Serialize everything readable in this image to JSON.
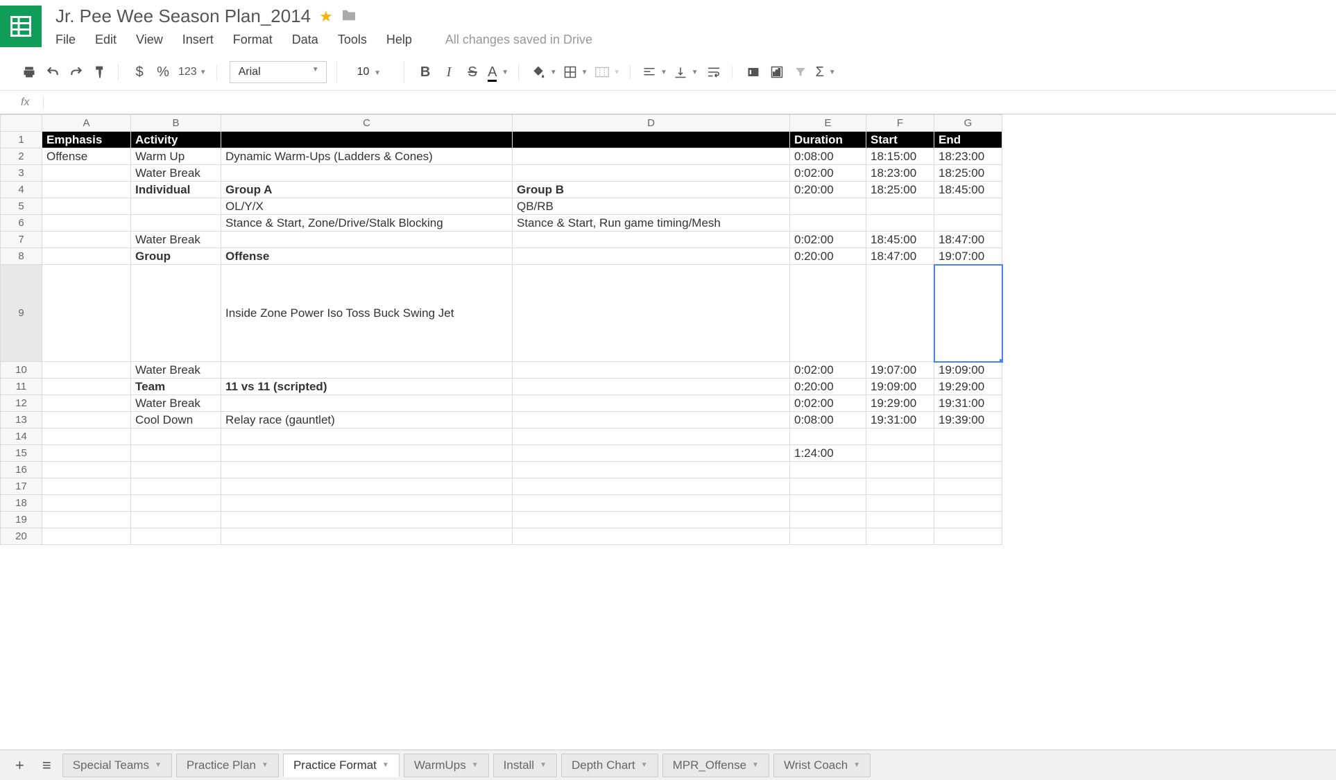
{
  "doc": {
    "title": "Jr. Pee Wee Season Plan_2014",
    "save_status": "All changes saved in Drive"
  },
  "menu": {
    "file": "File",
    "edit": "Edit",
    "view": "View",
    "insert": "Insert",
    "format": "Format",
    "data": "Data",
    "tools": "Tools",
    "help": "Help"
  },
  "toolbar": {
    "currency": "$",
    "percent": "%",
    "numfmt": "123",
    "font": "Arial",
    "fontsize": "10",
    "bold": "B",
    "italic": "I",
    "strike": "S",
    "textA": "A",
    "sigma": "Σ"
  },
  "fx": {
    "label": "fx"
  },
  "cols": {
    "A": "A",
    "B": "B",
    "C": "C",
    "D": "D",
    "E": "E",
    "F": "F",
    "G": "G"
  },
  "headers": {
    "emphasis": "Emphasis",
    "activity": "Activity",
    "duration": "Duration",
    "start": "Start",
    "end": "End"
  },
  "rows": {
    "r2": {
      "a": "Offense",
      "b": "Warm Up",
      "c": "Dynamic Warm-Ups (Ladders & Cones)",
      "e": "0:08:00",
      "f": "18:15:00",
      "g": "18:23:00"
    },
    "r3": {
      "b": "Water Break",
      "e": "0:02:00",
      "f": "18:23:00",
      "g": "18:25:00"
    },
    "r4": {
      "b": "Individual",
      "c": "Group A",
      "d": "Group B",
      "e": "0:20:00",
      "f": "18:25:00",
      "g": "18:45:00"
    },
    "r5": {
      "c": "OL/Y/X",
      "d": "QB/RB"
    },
    "r6": {
      "c": "Stance & Start, Zone/Drive/Stalk Blocking",
      "d": "Stance & Start, Run game timing/Mesh"
    },
    "r7": {
      "b": "Water Break",
      "e": "0:02:00",
      "f": "18:45:00",
      "g": "18:47:00"
    },
    "r8": {
      "b": "Group",
      "c": "Offense",
      "e": "0:20:00",
      "f": "18:47:00",
      "g": "19:07:00"
    },
    "r9": {
      "c": "Inside Zone\nPower\nIso\nToss\nBuck\nSwing\nJet"
    },
    "r10": {
      "b": "Water Break",
      "e": "0:02:00",
      "f": "19:07:00",
      "g": "19:09:00"
    },
    "r11": {
      "b": "Team",
      "c": "11 vs 11 (scripted)",
      "e": "0:20:00",
      "f": "19:09:00",
      "g": "19:29:00"
    },
    "r12": {
      "b": "Water Break",
      "e": "0:02:00",
      "f": "19:29:00",
      "g": "19:31:00"
    },
    "r13": {
      "b": "Cool Down",
      "c": "Relay race (gauntlet)",
      "e": "0:08:00",
      "f": "19:31:00",
      "g": "19:39:00"
    },
    "r15": {
      "e": "1:24:00"
    }
  },
  "rownums": {
    "r1": "1",
    "r2": "2",
    "r3": "3",
    "r4": "4",
    "r5": "5",
    "r6": "6",
    "r7": "7",
    "r8": "8",
    "r9": "9",
    "r10": "10",
    "r11": "11",
    "r12": "12",
    "r13": "13",
    "r14": "14",
    "r15": "15",
    "r16": "16",
    "r17": "17",
    "r18": "18",
    "r19": "19",
    "r20": "20"
  },
  "tabs": {
    "t0": "Special Teams",
    "t1": "Practice Plan",
    "t2": "Practice Format",
    "t3": "WarmUps",
    "t4": "Install",
    "t5": "Depth Chart",
    "t6": "MPR_Offense",
    "t7": "Wrist Coach"
  }
}
